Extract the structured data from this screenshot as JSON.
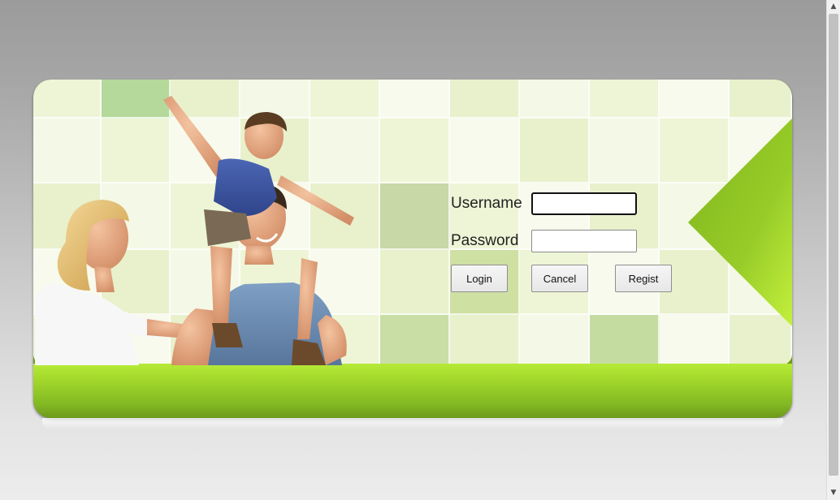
{
  "login": {
    "username_label": "Username",
    "password_label": "Password",
    "username_value": "",
    "password_value": "",
    "login_button": "Login",
    "cancel_button": "Cancel",
    "regist_button": "Regist"
  },
  "scrollbar": {
    "up_arrow": "▲",
    "down_arrow": "▼"
  },
  "colors": {
    "accent_green": "#9fd52a",
    "tile_light": "#eef4d6",
    "tile_dark": "#b7d48c"
  },
  "image": {
    "subject": "family-photo"
  }
}
